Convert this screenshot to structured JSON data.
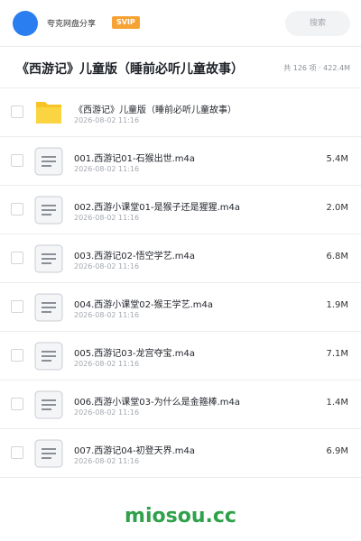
{
  "header": {
    "share_name": "夸克网盘分享",
    "badge": "SVIP",
    "search_placeholder": "搜索",
    "avatar_color": "#2a7ef0"
  },
  "folder": {
    "title": "《西游记》儿童版（睡前必听儿童故事）",
    "meta": "共 126 项 · 422.4M"
  },
  "items": [
    {
      "type": "folder",
      "name": "《西游记》儿童版（睡前必听儿童故事）",
      "date": "2026-08-02 11:16",
      "size": ""
    },
    {
      "type": "file",
      "name": "001.西游记01-石猴出世.m4a",
      "date": "2026-08-02 11:16",
      "size": "5.4M"
    },
    {
      "type": "file",
      "name": "002.西游小课堂01-是猴子还是猩猩.m4a",
      "date": "2026-08-02 11:16",
      "size": "2.0M"
    },
    {
      "type": "file",
      "name": "003.西游记02-悟空学艺.m4a",
      "date": "2026-08-02 11:16",
      "size": "6.8M"
    },
    {
      "type": "file",
      "name": "004.西游小课堂02-猴王学艺.m4a",
      "date": "2026-08-02 11:16",
      "size": "1.9M"
    },
    {
      "type": "file",
      "name": "005.西游记03-龙宫夺宝.m4a",
      "date": "2026-08-02 11:16",
      "size": "7.1M"
    },
    {
      "type": "file",
      "name": "006.西游小课堂03-为什么是金箍棒.m4a",
      "date": "2026-08-02 11:16",
      "size": "1.4M"
    },
    {
      "type": "file",
      "name": "007.西游记04-初登天界.m4a",
      "date": "2026-08-02 11:16",
      "size": "6.9M"
    }
  ],
  "watermark": "miosou.cc",
  "colors": {
    "folder_icon": "#f7c325",
    "watermark": "#2fa14a",
    "svip_badge": "#f7a234"
  }
}
